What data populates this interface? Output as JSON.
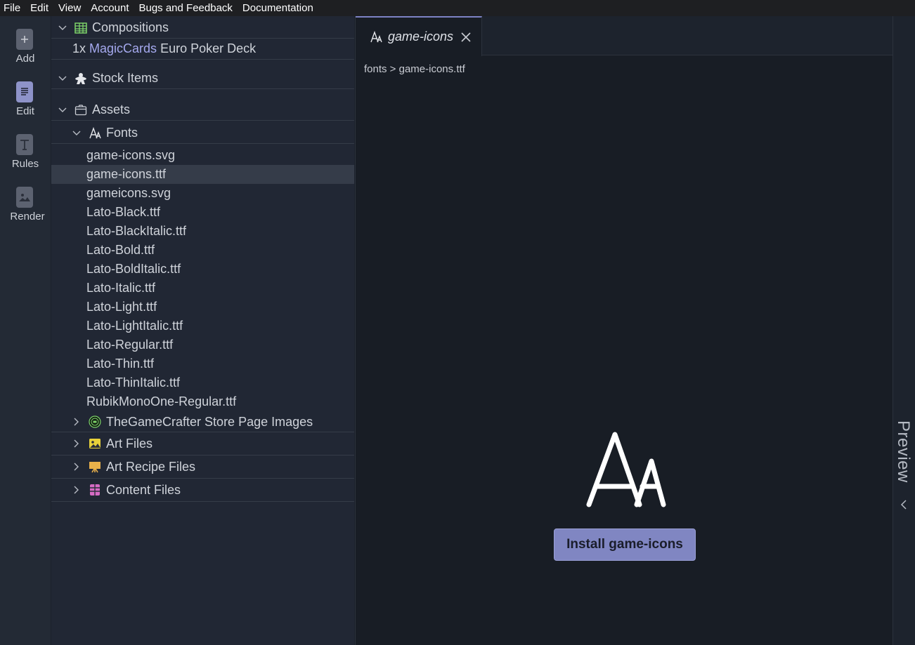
{
  "menu": [
    "File",
    "Edit",
    "View",
    "Account",
    "Bugs and Feedback",
    "Documentation"
  ],
  "activity": {
    "items": [
      {
        "label": "Add",
        "icon": "plus-icon"
      },
      {
        "label": "Edit",
        "icon": "document-icon"
      },
      {
        "label": "Rules",
        "icon": "text-icon"
      },
      {
        "label": "Render",
        "icon": "image-icon"
      }
    ]
  },
  "explorer": {
    "compositions": {
      "label": "Compositions",
      "item": {
        "count": "1x",
        "brand": "MagicCards",
        "name": "Euro Poker Deck"
      }
    },
    "stock_items": {
      "label": "Stock Items"
    },
    "assets": {
      "label": "Assets",
      "fonts": {
        "label": "Fonts",
        "files": [
          "game-icons.svg",
          "game-icons.ttf",
          "gameicons.svg",
          "Lato-Black.ttf",
          "Lato-BlackItalic.ttf",
          "Lato-Bold.ttf",
          "Lato-BoldItalic.ttf",
          "Lato-Italic.ttf",
          "Lato-Light.ttf",
          "Lato-LightItalic.ttf",
          "Lato-Regular.ttf",
          "Lato-Thin.ttf",
          "Lato-ThinItalic.ttf",
          "RubikMonoOne-Regular.ttf"
        ],
        "selected": "game-icons.ttf"
      },
      "folders": [
        "TheGameCrafter Store Page Images",
        "Art Files",
        "Art Recipe Files",
        "Content Files"
      ]
    }
  },
  "editor": {
    "tab_label": "game-icons",
    "breadcrumb": "fonts > game-icons.ttf",
    "install_label": "Install game-icons"
  },
  "preview": {
    "label": "Preview"
  },
  "colors": {
    "accent": "#8086c2",
    "brand_link": "#a5a9ee",
    "compositions_icon": "#7ed46a",
    "art_files_icon": "#e8d23a",
    "art_recipe_icon": "#e8b04a",
    "content_files_icon": "#d66bc4"
  }
}
